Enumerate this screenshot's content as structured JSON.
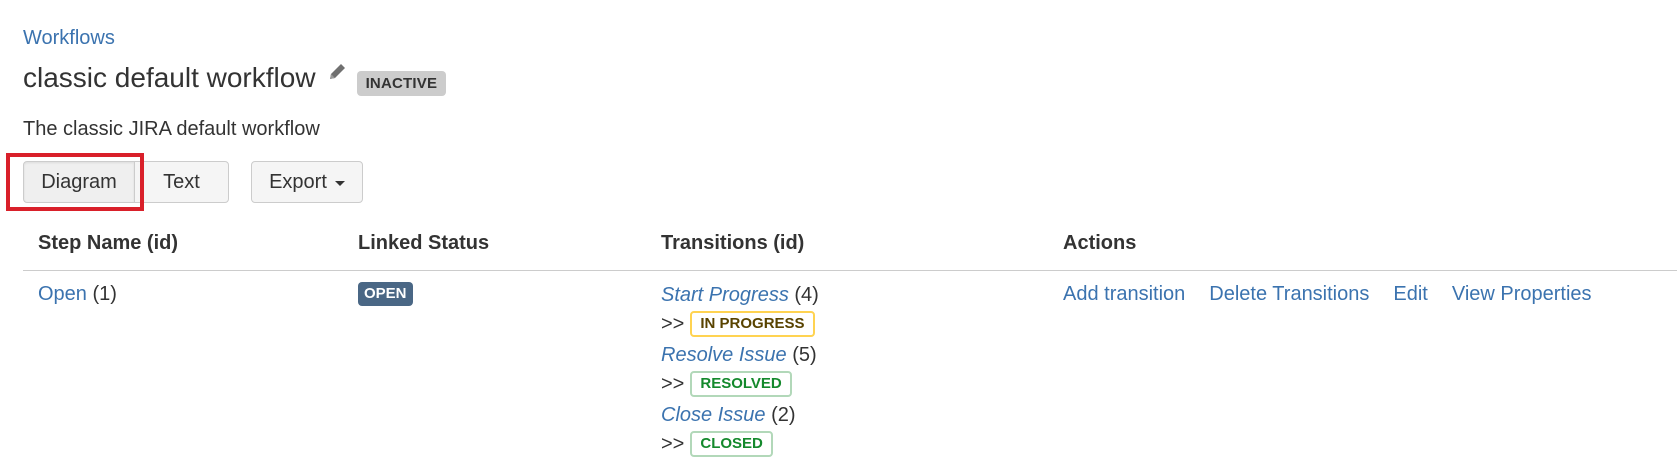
{
  "breadcrumb": {
    "label": "Workflows"
  },
  "workflow": {
    "title": "classic default workflow",
    "status": "INACTIVE",
    "description": "The classic JIRA default workflow"
  },
  "toolbar": {
    "diagram_label": "Diagram",
    "text_label": "Text",
    "export_label": "Export"
  },
  "table": {
    "headers": [
      "Step Name (id)",
      "Linked Status",
      "Transitions (id)",
      "Actions"
    ],
    "rows": [
      {
        "step_name": "Open",
        "step_id": "(1)",
        "linked_status": "OPEN",
        "transitions": [
          {
            "name": "Start Progress",
            "id": "(4)",
            "arrow": ">>",
            "target": "IN PROGRESS"
          },
          {
            "name": "Resolve Issue",
            "id": "(5)",
            "arrow": ">>",
            "target": "RESOLVED"
          },
          {
            "name": "Close Issue",
            "id": "(2)",
            "arrow": ">>",
            "target": "CLOSED"
          }
        ],
        "actions": [
          "Add transition",
          "Delete Transitions",
          "Edit",
          "View Properties"
        ]
      }
    ]
  },
  "colors": {
    "link": "#3b73af",
    "highlight": "#d9202a",
    "open_lozenge": "#4a6785"
  }
}
